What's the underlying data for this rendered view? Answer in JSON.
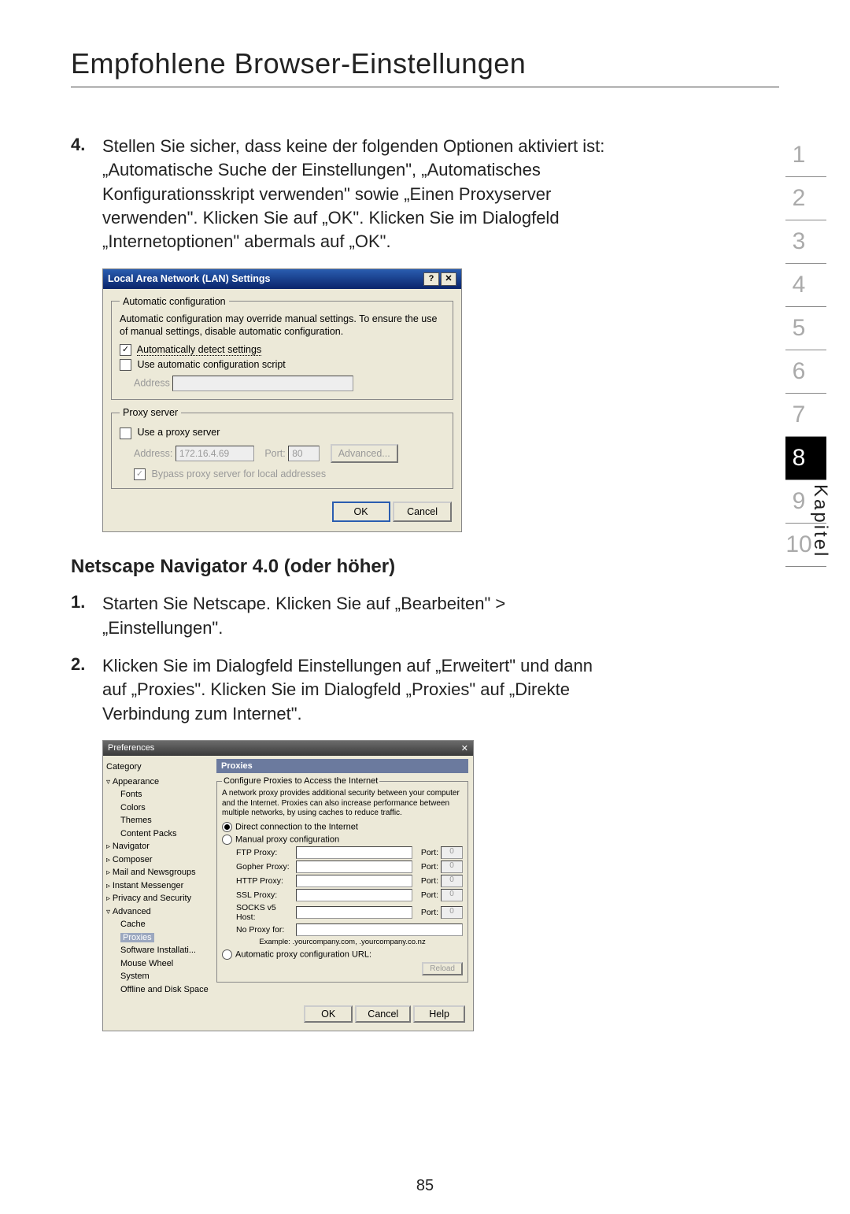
{
  "page_title": "Empfohlene Browser-Einstellungen",
  "side": {
    "label": "Kapitel",
    "items": [
      "1",
      "2",
      "3",
      "4",
      "5",
      "6",
      "7",
      "8",
      "9",
      "10"
    ],
    "active": "8"
  },
  "step4": {
    "num": "4.",
    "text": "Stellen Sie sicher, dass keine der folgenden Optionen aktiviert ist: „Automatische Suche der Einstellungen\", „Automatisches Konfigurationsskript verwenden\" sowie „Einen Proxyserver verwenden\". Klicken Sie auf „OK\". Klicken Sie im Dialogfeld „Internetoptionen\" abermals auf „OK\"."
  },
  "lan": {
    "title": "Local Area Network (LAN) Settings",
    "help_btn": "?",
    "close_btn": "✕",
    "group1": "Automatic configuration",
    "g1_text": "Automatic configuration may override manual settings. To ensure the use of manual settings, disable automatic configuration.",
    "auto_detect": "Automatically detect settings",
    "use_script": "Use automatic configuration script",
    "address_label": "Address",
    "group2": "Proxy server",
    "use_proxy": "Use a proxy server",
    "addr_label2": "Address:",
    "addr_val": "172.16.4.69",
    "port_label": "Port:",
    "port_val": "80",
    "advanced": "Advanced...",
    "bypass": "Bypass proxy server for local addresses",
    "ok": "OK",
    "cancel": "Cancel"
  },
  "subhead": "Netscape Navigator 4.0 (oder höher)",
  "ns1": {
    "num": "1.",
    "text": "Starten Sie Netscape. Klicken Sie auf „Bearbeiten\" > „Einstellungen\"."
  },
  "ns2": {
    "num": "2.",
    "text": "Klicken Sie im Dialogfeld Einstellungen auf „Erweitert\" und dann auf „Proxies\". Klicken Sie im Dialogfeld „Proxies\" auf „Direkte Verbindung zum Internet\"."
  },
  "prefs": {
    "title": "Preferences",
    "close_btn": "✕",
    "category_label": "Category",
    "tree": {
      "appearance": "Appearance",
      "fonts": "Fonts",
      "colors": "Colors",
      "themes": "Themes",
      "content_packs": "Content Packs",
      "navigator": "Navigator",
      "composer": "Composer",
      "mail": "Mail and Newsgroups",
      "im": "Instant Messenger",
      "privacy": "Privacy and Security",
      "advanced": "Advanced",
      "cache": "Cache",
      "proxies": "Proxies",
      "software": "Software Installati...",
      "mouse": "Mouse Wheel",
      "system": "System",
      "offline": "Offline and Disk Space"
    },
    "panel_head": "Proxies",
    "fs_legend": "Configure Proxies to Access the Internet",
    "blurb": "A network proxy provides additional security between your computer and the Internet. Proxies can also increase performance between multiple networks, by using caches to reduce traffic.",
    "opt_direct": "Direct connection to the Internet",
    "opt_manual": "Manual proxy configuration",
    "rows": {
      "ftp": "FTP Proxy:",
      "gopher": "Gopher Proxy:",
      "http": "HTTP Proxy:",
      "ssl": "SSL Proxy:",
      "socks": "SOCKS v5 Host:",
      "noproxy": "No Proxy for:"
    },
    "port_label": "Port:",
    "port_ph": "0",
    "example": "Example: .yourcompany.com, .yourcompany.co.nz",
    "opt_auto": "Automatic proxy configuration URL:",
    "reload": "Reload",
    "ok": "OK",
    "cancel": "Cancel",
    "help": "Help"
  },
  "page_number": "85"
}
